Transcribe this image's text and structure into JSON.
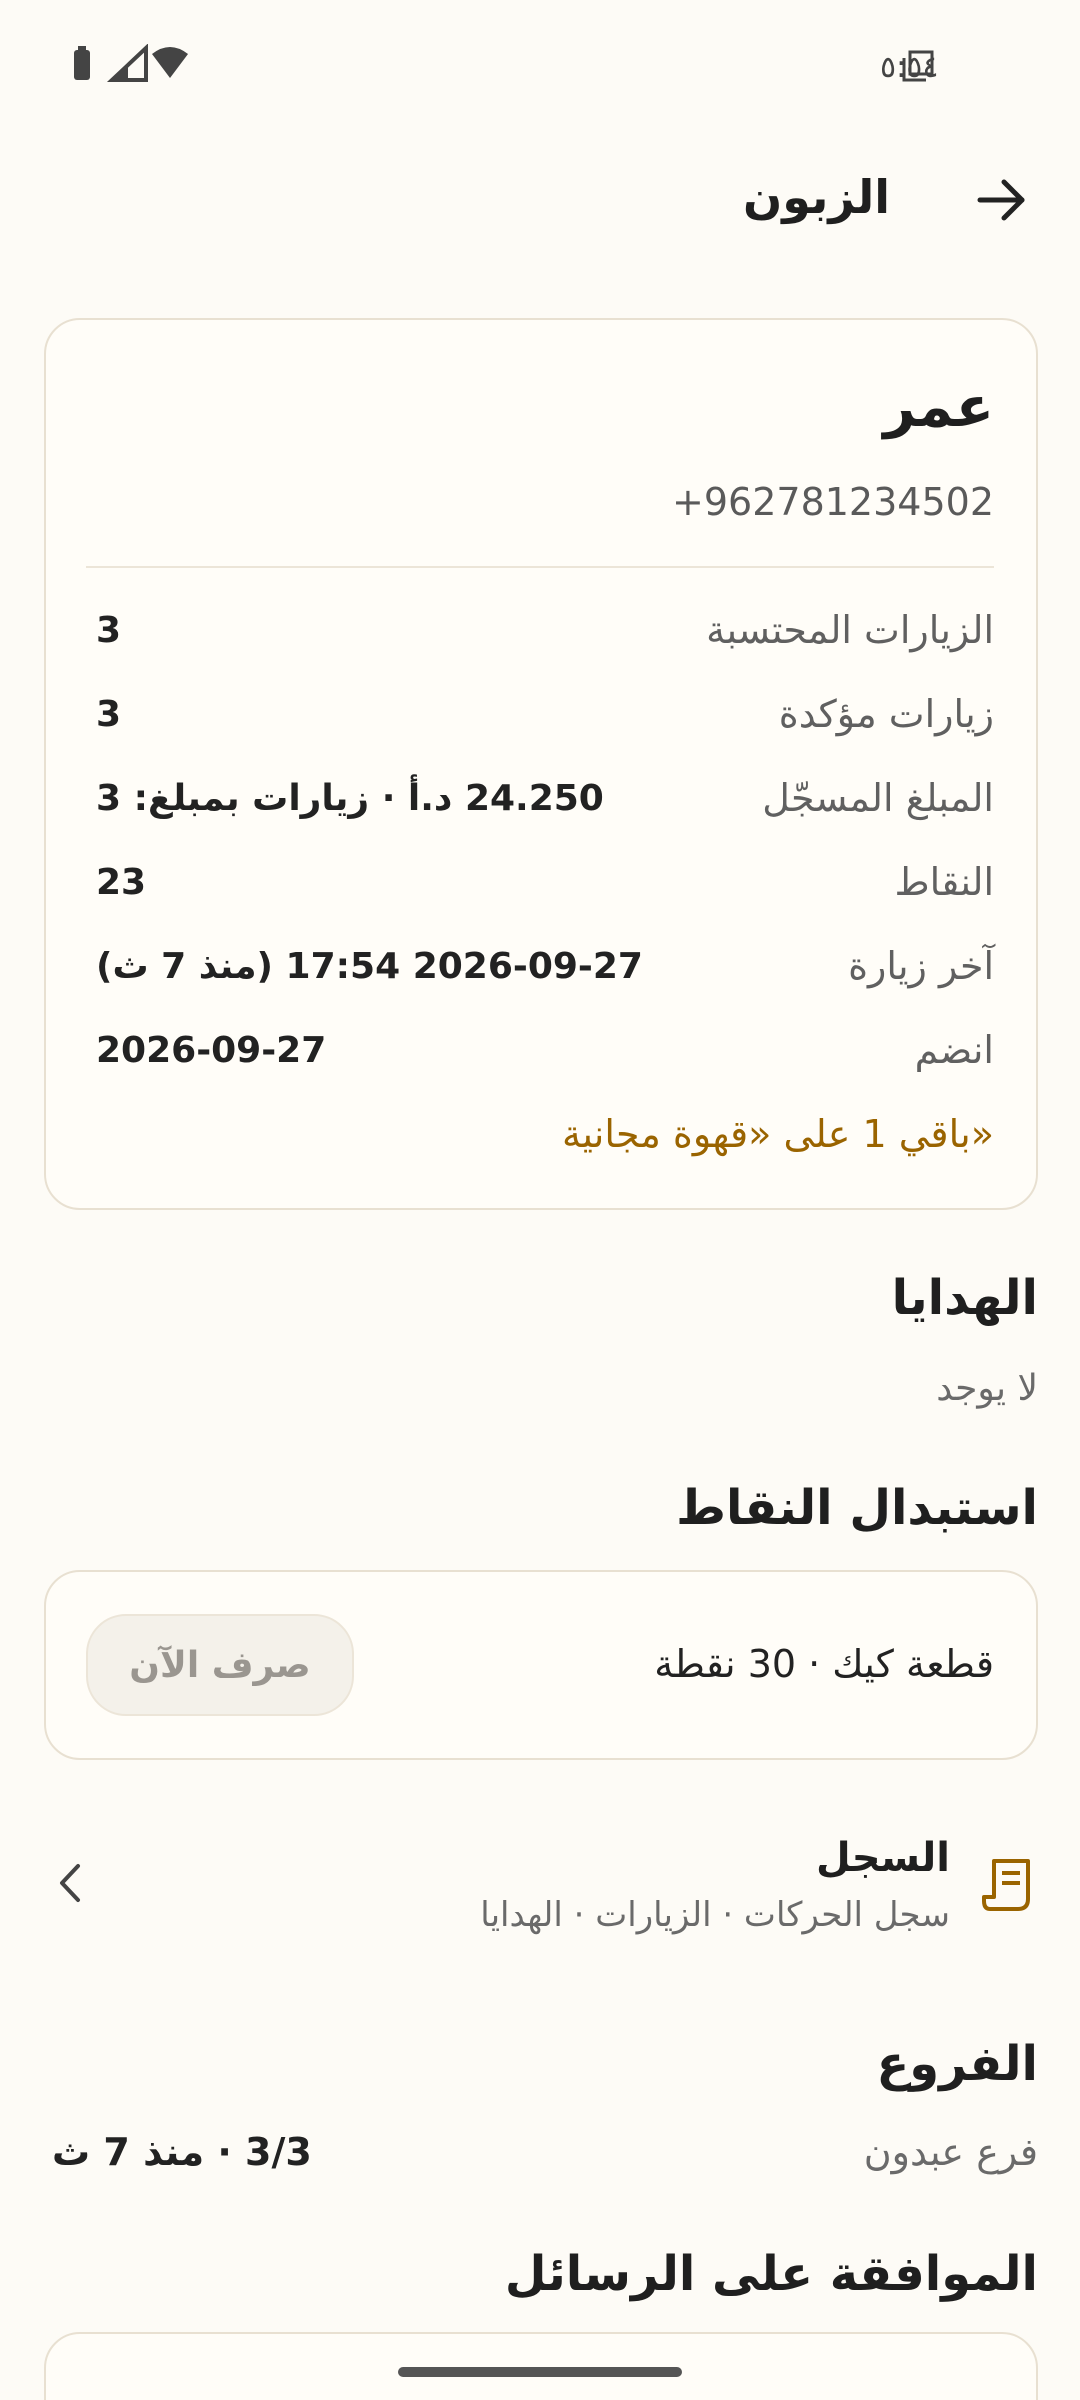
{
  "status_bar": {
    "time": "٥:٥٤"
  },
  "header": {
    "title": "الزبون"
  },
  "customer": {
    "name": "عمر",
    "phone": "+962781234502",
    "stats": [
      {
        "label": "الزيارات المحتسبة",
        "value": "3"
      },
      {
        "label": "زيارات مؤكدة",
        "value": "3"
      },
      {
        "label": "المبلغ المسجّل",
        "value": "24.250 د.أ · زيارات بمبلغ: 3"
      },
      {
        "label": "النقاط",
        "value": "23"
      },
      {
        "label": "آخر زيارة",
        "value": "2026-09-27 17:54 (منذ 7 ث)"
      },
      {
        "label": "انضم",
        "value": "2026-09-27"
      }
    ],
    "progress_note": "باقي 1 على «قهوة مجانية»"
  },
  "gifts": {
    "title": "الهدايا",
    "empty_text": "لا يوجد"
  },
  "redeem": {
    "title": "استبدال النقاط",
    "item_text": "قطعة كيك · 30 نقطة",
    "button_label": "صرف الآن"
  },
  "history": {
    "title": "السجل",
    "subtitle": "سجل الحركات · الزيارات · الهدايا"
  },
  "branches": {
    "title": "الفروع",
    "items": [
      {
        "name": "فرع عبدون",
        "value": "3/3 · منذ 7 ث"
      }
    ]
  },
  "consent": {
    "title": "الموافقة على الرسائل"
  },
  "colors": {
    "accent": "#9a6400",
    "background": "#fdfbf6",
    "border": "#e8e0d1"
  },
  "icons": [
    "battery-icon",
    "signal-icon",
    "wifi-icon",
    "copy-icon",
    "back-arrow-icon",
    "receipt-icon",
    "chevron-left-icon"
  ]
}
